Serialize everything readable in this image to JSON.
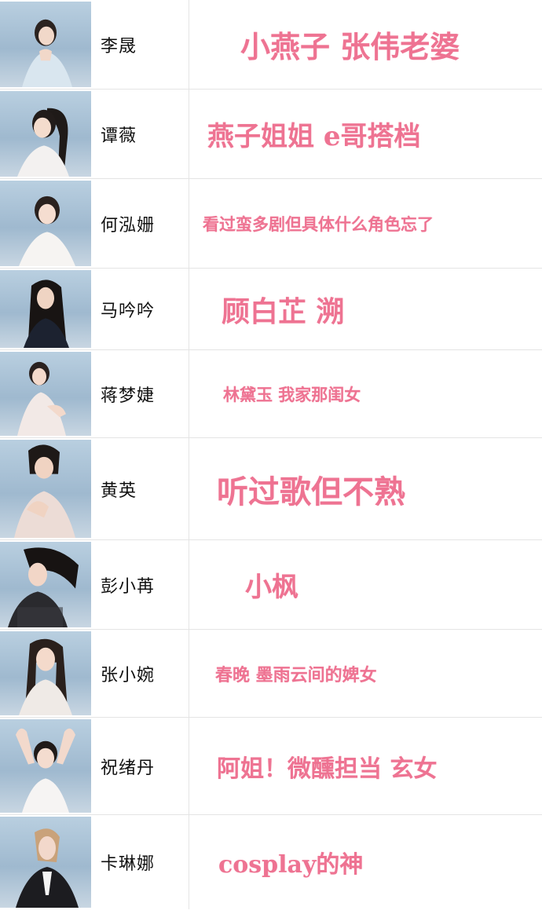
{
  "rows": [
    {
      "name": "李晟",
      "comment": "小燕子 张伟老婆"
    },
    {
      "name": "谭薇",
      "comment": "燕子姐姐 e哥搭档"
    },
    {
      "name": "何泓姗",
      "comment": "看过蛮多剧但具体什么角色忘了"
    },
    {
      "name": "马吟吟",
      "comment": "顾白芷 溯"
    },
    {
      "name": "蒋梦婕",
      "comment": "林黛玉 我家那闺女"
    },
    {
      "name": "黄英",
      "comment": "听过歌但不熟"
    },
    {
      "name": "彭小苒",
      "comment": "小枫"
    },
    {
      "name": "张小婉",
      "comment": "春晚 墨雨云间的婢女"
    },
    {
      "name": "祝绪丹",
      "comment": "阿姐！微醺担当  玄女"
    },
    {
      "name": "卡琳娜",
      "comment": "cosplay的神"
    }
  ],
  "colors": {
    "comment": "#ee7392",
    "sky": "#a9c2d6",
    "border": "#e4e4e4"
  }
}
